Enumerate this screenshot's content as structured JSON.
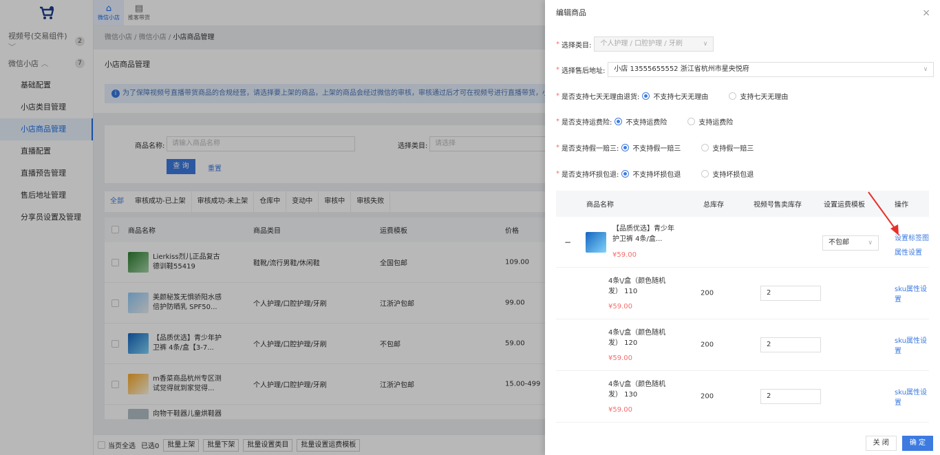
{
  "sidebar": {
    "group1": {
      "label": "视频号(交易组件)",
      "badge": "2"
    },
    "group2": {
      "label": "微信小店",
      "badge": "7"
    },
    "items": [
      "基础配置",
      "小店类目管理",
      "小店商品管理",
      "直播配置",
      "直播预告管理",
      "售后地址管理",
      "分享员设置及管理"
    ]
  },
  "topbar": {
    "tabs": [
      "微信小店",
      "推客带货"
    ]
  },
  "breadcrumb": {
    "a": "微信小店",
    "b": "微信小店",
    "c": "小店商品管理"
  },
  "page": {
    "title": "小店商品管理",
    "notice": "为了保障视频号直播带货商品的合规经营，请选择要上架的商品，上架的商品会经过微信的审核，审核通过后才可在视频号进行直播带货，小程序"
  },
  "filter": {
    "name_label": "商品名称:",
    "name_placeholder": "请输入商品名称",
    "cat_label": "选择类目:",
    "cat_placeholder": "请选择",
    "query": "查 询",
    "reset": "重置"
  },
  "tabs": [
    "全部",
    "审核成功-已上架",
    "审核成功-未上架",
    "仓库中",
    "变动中",
    "审核中",
    "审核失败"
  ],
  "table": {
    "headers": [
      "商品名称",
      "商品类目",
      "运费模板",
      "价格"
    ],
    "rows": [
      {
        "name": "Lierkiss烈儿正品复古德训鞋55419",
        "cat": "鞋靴/流行男鞋/休闲鞋",
        "ship": "全国包邮",
        "price": "109.00"
      },
      {
        "name": "美颜秘笈无惧骄阳水感倍护防晒乳 SPF50...",
        "cat": "个人护理/口腔护理/牙刷",
        "ship": "江浙沪包邮",
        "price": "99.00"
      },
      {
        "name": "【品质优选】青少年护卫裤 4条/盒【3-7...",
        "cat": "个人护理/口腔护理/牙刷",
        "ship": "不包邮",
        "price": "59.00"
      },
      {
        "name": "m香菜商品杭州专区测试觉得就到家觉得...",
        "cat": "个人护理/口腔护理/牙刷",
        "ship": "江浙沪包邮",
        "price": "15.00-499"
      },
      {
        "name": "向物干鞋器儿童烘鞋器",
        "cat": "",
        "ship": "",
        "price": ""
      }
    ]
  },
  "footer": {
    "select_all": "当页全选",
    "selected": "已选0",
    "buttons": [
      "批量上架",
      "批量下架",
      "批量设置类目",
      "批量设置运费模板"
    ]
  },
  "drawer": {
    "title": "编辑商品",
    "close_icon": "×",
    "category": {
      "label": "选择类目:",
      "value": "个人护理 / 口腔护理 / 牙刷"
    },
    "address": {
      "label": "选择售后地址:",
      "value": "小店 13555655552 浙江省杭州市星央悦府"
    },
    "q1": {
      "label": "是否支持七天无理由退货:",
      "opt1": "不支持七天无理由",
      "opt2": "支持七天无理由"
    },
    "q2": {
      "label": "是否支持运费险:",
      "opt1": "不支持运费险",
      "opt2": "支持运费险"
    },
    "q3": {
      "label": "是否支持假一赔三:",
      "opt1": "不支持假一赔三",
      "opt2": "支持假一赔三"
    },
    "q4": {
      "label": "是否支持坏损包退:",
      "opt1": "不支持坏损包退",
      "opt2": "支持坏损包退"
    },
    "table": {
      "headers": [
        "商品名称",
        "总库存",
        "视频号售卖库存",
        "设置运费模板",
        "操作"
      ],
      "product": {
        "name": "【品质优选】青少年护卫裤 4条/盒...",
        "price": "¥59.00",
        "ship": "不包邮",
        "op1": "设置标签图",
        "op2": "属性设置",
        "collapse": "−"
      },
      "skus": [
        {
          "name": "4条\\/盒（颜色随机发） 110",
          "price": "¥59.00",
          "stock": "200",
          "sale": "2",
          "op": "sku属性设置"
        },
        {
          "name": "4条\\/盒（颜色随机发） 120",
          "price": "¥59.00",
          "stock": "200",
          "sale": "2",
          "op": "sku属性设置"
        },
        {
          "name": "4条\\/盒（颜色随机发） 130",
          "price": "¥59.00",
          "stock": "200",
          "sale": "2",
          "op": "sku属性设置"
        }
      ]
    },
    "buttons": {
      "close": "关 闭",
      "ok": "确 定"
    }
  },
  "colors": {
    "primary": "#3d7be0",
    "annotation_arrow": "#e8302a"
  }
}
